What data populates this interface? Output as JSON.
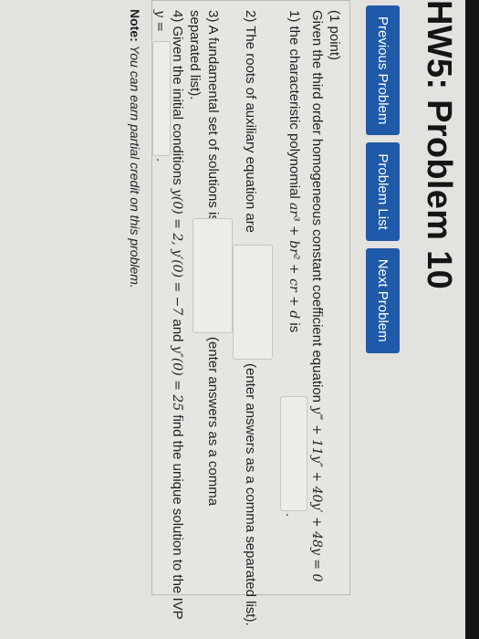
{
  "header": {
    "title": "HW5: Problem 10"
  },
  "nav": {
    "previous_label": "Previous Problem",
    "list_label": "Problem List",
    "next_label": "Next Problem"
  },
  "problem": {
    "points": "(1 point)",
    "statement_prefix": "Given the third order homogeneous constant coefficient equation",
    "equation": "y‴ + 11y″ + 40y′ + 48y = 0",
    "q1_prefix": "1) the characteristic polynomial",
    "q1_poly": "ar³ + br² + cr + d",
    "q1_suffix": "is",
    "q1_value": "",
    "q1_end": ".",
    "q2_prefix": "2) The roots of auxiliary equation are",
    "q2_value": "",
    "q2_suffix": "(enter answers as a comma separated list).",
    "q3_prefix": "3) A fundamental set of solutions is",
    "q3_value": "",
    "q3_suffix": "(enter answers as a comma",
    "q3_suffix2": "separated list).",
    "q4_prefix": "4) Given the initial conditions",
    "q4_conditions": "y(0) = 2, y′(0) = −7",
    "q4_and": "and",
    "q4_condition3": "y″(0) = 25",
    "q4_suffix": "find the unique solution to the IVP",
    "q4_lhs": "y =",
    "q4_value": "",
    "q4_end": "."
  },
  "note": {
    "label": "Note:",
    "text": "You can earn partial credit on this problem."
  }
}
